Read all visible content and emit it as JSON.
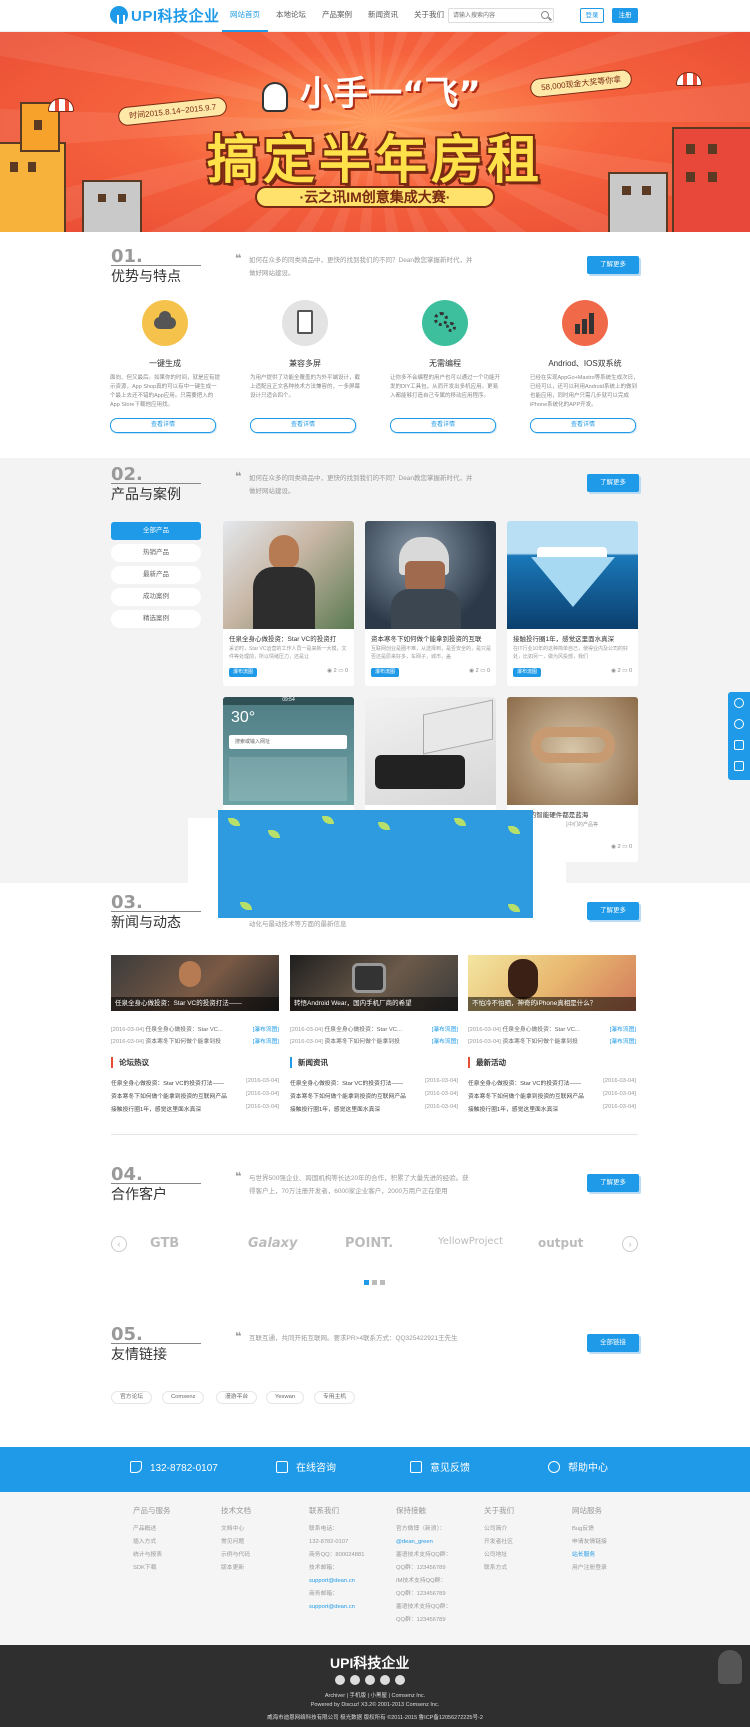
{
  "header": {
    "logo_text": "UPI科技企业",
    "nav": [
      "网站首页",
      "本地论坛",
      "产品案例",
      "新闻资讯",
      "关于我们"
    ],
    "search_placeholder": "请输入搜索内容",
    "login": "登录",
    "register": "注册"
  },
  "banner": {
    "date": "时间2015.8.14~2015.9.7",
    "prize": "58,000现金大奖等你拿",
    "headline_top": "小手一“飞”",
    "headline": "搞定半年房租",
    "subtitle": "·云之讯IM创意集成大赛·"
  },
  "sections": {
    "s1": {
      "num": "01.",
      "title": "优势与特点",
      "desc": "如何在众多的同类商品中，更快的找到我们的不同？Dean教您掌握新时代，并做好网站建设。",
      "more": "了解更多"
    },
    "s2": {
      "num": "02.",
      "title": "产品与案例",
      "desc": "如何在众多的同类商品中，更快的找到我们的不同？Dean教您掌握新时代，并做好网站建设。",
      "more": "了解更多"
    },
    "s3": {
      "num": "03.",
      "title": "新闻与动态",
      "desc": "动化与最动技术等方面的最新信息",
      "more": "了解更多"
    },
    "s4": {
      "num": "04.",
      "title": "合作客户",
      "desc": "与世界500强企业、跨国机构等长达20年的合作，积累了大量先进的经验。获得客户上，70万注册开发者，6000家企业客户，2000万用户正在使用",
      "more": "了解更多"
    },
    "s5": {
      "num": "05.",
      "title": "友情链接",
      "desc": "互联互通，共同开拓互联网。要求PR>4联系方式：QQ325422921王先生",
      "more": "全部链接"
    }
  },
  "features": [
    {
      "title": "一键生成",
      "desc": "面向、但又最后。如果你的时间，就是应有提示资源，App Shop真的可以有中一键生成一个最上去还不错的App应用。只需要把入的App Store下载他应用找。",
      "button": "查看详情",
      "color": "#f5c24c",
      "icon": "cloud-icon"
    },
    {
      "title": "兼容多屏",
      "desc": "为用户提供了功能全覆盖的为外平端设计，截上适配且正文各种技术方法兼容的，一多屏幕设计只适合四个。",
      "button": "查看详情",
      "color": "#e3e3e3",
      "icon": "tablet-icon"
    },
    {
      "title": "无需编程",
      "desc": "让你多不会编程的用户也可以通过一个功能开发的DIY工具包，从而开发出多机应用。更易入都能够打造自己专属的移动应用程序。",
      "button": "查看详情",
      "color": "#3dbf9e",
      "icon": "gears-icon"
    },
    {
      "title": "Andriod、IOS双系统",
      "desc": "已经在实现AppGo+Mastro等系统生成次日，已经可以，还可以利用Android系统上的做到也能应用，同时用户只需几步就可以完成iPhone系统化的APP开发。",
      "button": "查看详情",
      "color": "#f06a4a",
      "icon": "bar-chart-icon"
    }
  ],
  "products": {
    "side": [
      "全部产品",
      "热销产品",
      "最新产品",
      "成功案例",
      "精选案例"
    ],
    "cards": [
      {
        "title": "任泉全身心做投资：Star VC的投资打",
        "desc": "采访时，Star VC运营的工作人员一是来新一大模，文件等处理前，所以情绪压力，还是让",
        "tag": "瀑布流图",
        "views": "2",
        "comments": "0"
      },
      {
        "title": "资本寒冬下如何做个能拿到投资的互联",
        "desc": "互联网创业是圈不难，从选择到，是否安全的，是只是否还是原来好多，车网子，城市，盖",
        "tag": "瀑布流图",
        "views": "2",
        "comments": "0"
      },
      {
        "title": "接触投行圈1年，感觉这里面水真深",
        "desc": "在IT行业10年的这种简单自己，使得业内及公司的好处，比如另一，做为风投部，我们",
        "tag": "瀑布流图",
        "views": "2",
        "comments": "0"
      },
      {
        "title": "",
        "desc": "",
        "tag": "",
        "views": "",
        "comments": ""
      },
      {
        "title": "",
        "desc": "",
        "tag": "",
        "views": "",
        "comments": ""
      },
      {
        "title": "联网+的智能硬件都是蓝海",
        "desc": "业某者未的产品都在向是中们的产品等",
        "tag": "",
        "views": "2",
        "comments": "0"
      }
    ],
    "phone_time": "09:54",
    "phone_temp": "30°",
    "phone_search": "搜索或输入网址"
  },
  "news": {
    "features": [
      {
        "caption": "任泉全身心做投资：Star VC的投资打法——"
      },
      {
        "caption": "转悟Android Wear，国内手机厂商的希望"
      },
      {
        "caption": "不怕冷不怕晒，神奇的iPhone真相是什么？"
      }
    ],
    "lines": [
      [
        {
          "date": "[2016-03-04]",
          "text": "任泉全身心做投资：Star VC...",
          "tag": "[瀑布流图]"
        },
        {
          "date": "[2016-03-04]",
          "text": "资本寒冬下如何做个能拿到投",
          "tag": "[瀑布流图]"
        }
      ],
      [
        {
          "date": "[2016-03-04]",
          "text": "任泉全身心做投资：Star VC...",
          "tag": "[瀑布流图]"
        },
        {
          "date": "[2016-03-04]",
          "text": "资本寒冬下如何做个能拿到投",
          "tag": "[瀑布流图]"
        }
      ],
      [
        {
          "date": "[2016-03-04]",
          "text": "任泉全身心做投资：Star VC...",
          "tag": "[瀑布流图]"
        },
        {
          "date": "[2016-03-04]",
          "text": "资本寒冬下如何做个能拿到投",
          "tag": "[瀑布流图]"
        }
      ]
    ],
    "columns": [
      {
        "title": "论坛热议",
        "items": [
          {
            "text": "任泉全身心做投资：Star VC的投资打法——",
            "date": "[2016-03-04]"
          },
          {
            "text": "资本寒冬下如何做个能拿到投资的互联网产品",
            "date": "[2016-03-04]"
          },
          {
            "text": "接触投行圈1年，感觉这里面水真深",
            "date": "[2016-03-04]"
          }
        ]
      },
      {
        "title": "新闻资讯",
        "items": [
          {
            "text": "任泉全身心做投资：Star VC的投资打法——",
            "date": "[2016-03-04]"
          },
          {
            "text": "资本寒冬下如何做个能拿到投资的互联网产品",
            "date": "[2016-03-04]"
          },
          {
            "text": "接触投行圈1年，感觉这里面水真深",
            "date": "[2016-03-04]"
          }
        ]
      },
      {
        "title": "最新活动",
        "items": [
          {
            "text": "任泉全身心做投资：Star VC的投资打法——",
            "date": "[2016-03-04]"
          },
          {
            "text": "资本寒冬下如何做个能拿到投资的互联网产品",
            "date": "[2016-03-04]"
          },
          {
            "text": "接触投行圈1年，感觉这里面水真深",
            "date": "[2016-03-04]"
          }
        ]
      }
    ]
  },
  "partners": [
    "GTB",
    "Galaxy",
    "POINT.",
    "YellowProject",
    "output"
  ],
  "links": [
    "官方论坛",
    "Comsenz",
    "漫游平台",
    "Yeswan",
    "专用主机"
  ],
  "bluebar": {
    "phone": "132-8782-0107",
    "consult": "在线咨询",
    "feedback": "意见反馈",
    "help": "帮助中心"
  },
  "footer_cols": [
    {
      "title": "产品与服务",
      "items": [
        "产品概述",
        "插入方式",
        "统计与报表",
        "SDK下载"
      ]
    },
    {
      "title": "技术文档",
      "items": [
        "文档中心",
        "常见问题",
        "示例与代码",
        "版本更新"
      ]
    },
    {
      "title": "联系我们",
      "items": [
        "联系电话：",
        "132-8782-0107",
        "商务QQ：800024881",
        "技术邮箱：",
        "support@dean.cn",
        "商务邮箱：",
        "support@dean.cn"
      ]
    },
    {
      "title": "保持接触",
      "items": [
        "官方微博（新浪）：",
        "@dean_green",
        "塞语技术支持QQ群：",
        "QQ群：123456789",
        "IM技术支持QQ群：",
        "QQ群：123456789",
        "塞语技术支持QQ群：",
        "QQ群：123456789"
      ]
    },
    {
      "title": "关于我们",
      "items": [
        "公司简介",
        "开发者社区",
        "公司地址",
        "联系方式"
      ]
    },
    {
      "title": "网站服务",
      "items": [
        "Bug反馈",
        "申请友情链接",
        "站长服务",
        "用户注册登录"
      ]
    }
  ],
  "bottom": {
    "logo": "UPI科技企业",
    "links": "Archiver | 手机版 | 小黑屋 | Comsenz Inc.",
    "powered": "Powered by Discuz! X3.2© 2001-2013 Comsenz Inc.",
    "copyright": "威海市迪恩网络科技有限公司 极光数据 版权所有 ©2011-2015 鲁ICP备12056272225号-2"
  }
}
